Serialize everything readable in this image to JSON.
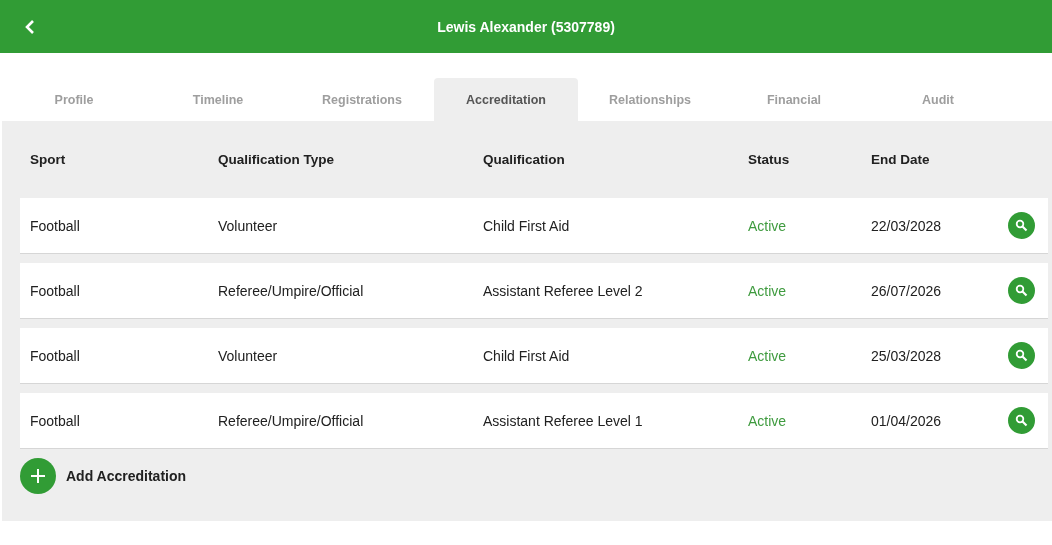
{
  "header": {
    "title": "Lewis Alexander (5307789)"
  },
  "tabs": [
    {
      "label": "Profile",
      "selected": false
    },
    {
      "label": "Timeline",
      "selected": false
    },
    {
      "label": "Registrations",
      "selected": false
    },
    {
      "label": "Accreditation",
      "selected": true
    },
    {
      "label": "Relationships",
      "selected": false
    },
    {
      "label": "Financial",
      "selected": false
    },
    {
      "label": "Audit",
      "selected": false
    }
  ],
  "table": {
    "columns": [
      "Sport",
      "Qualification Type",
      "Qualification",
      "Status",
      "End Date"
    ],
    "rows": [
      {
        "sport": "Football",
        "type": "Volunteer",
        "qualification": "Child First Aid",
        "status": "Active",
        "end_date": "22/03/2028"
      },
      {
        "sport": "Football",
        "type": "Referee/Umpire/Official",
        "qualification": "Assistant Referee Level 2",
        "status": "Active",
        "end_date": "26/07/2026"
      },
      {
        "sport": "Football",
        "type": "Volunteer",
        "qualification": "Child First Aid",
        "status": "Active",
        "end_date": "25/03/2028"
      },
      {
        "sport": "Football",
        "type": "Referee/Umpire/Official",
        "qualification": "Assistant Referee Level 1",
        "status": "Active",
        "end_date": "01/04/2026"
      }
    ]
  },
  "add_button": {
    "label": "Add Accreditation"
  }
}
